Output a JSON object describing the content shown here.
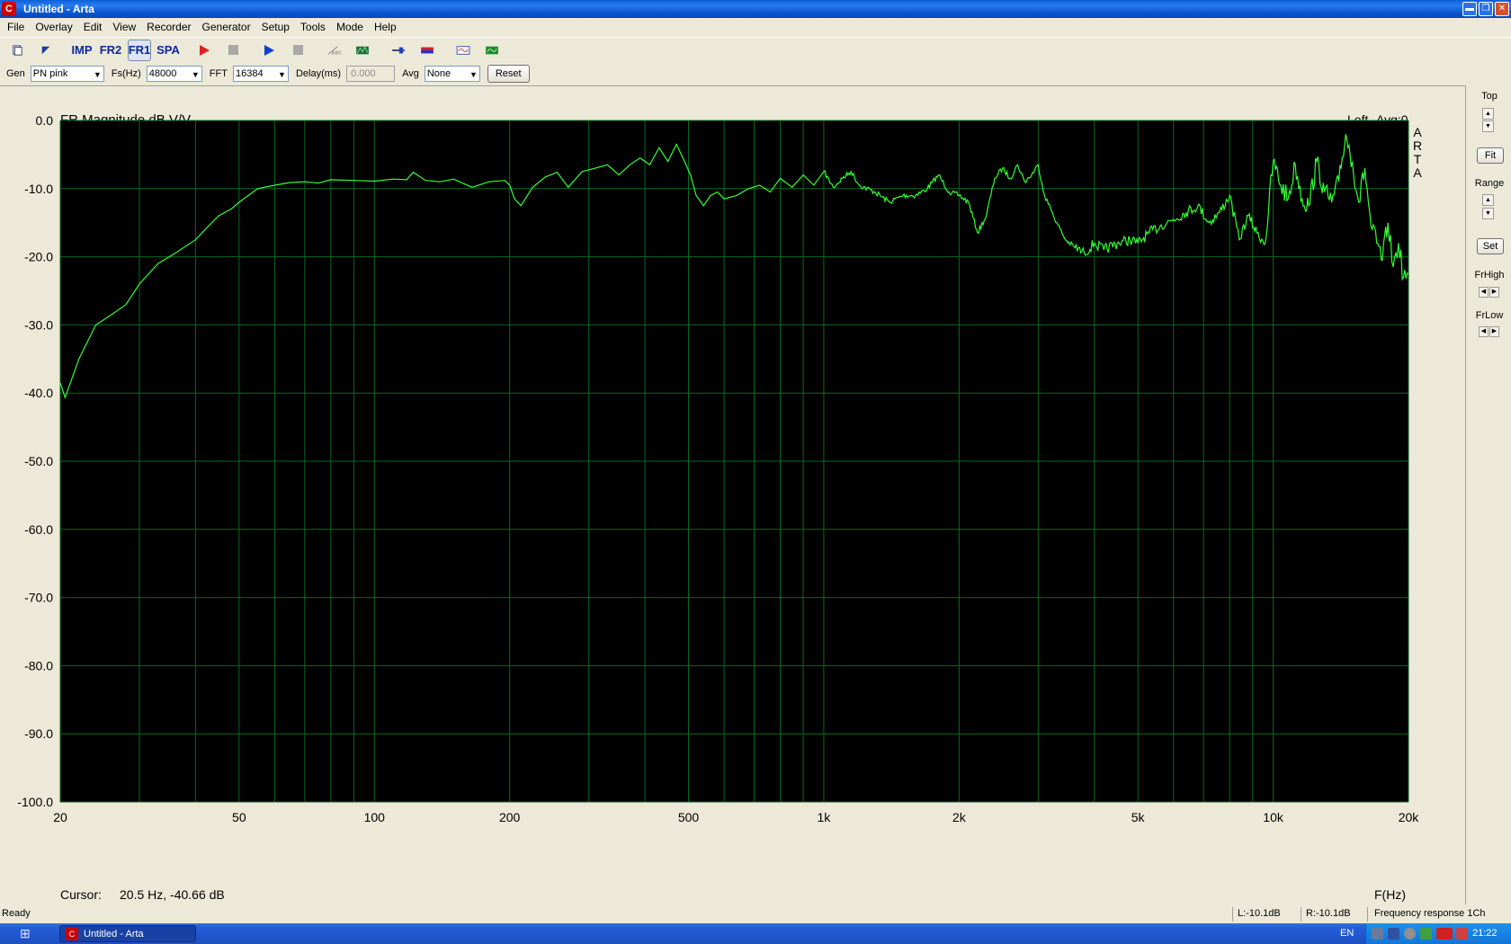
{
  "window": {
    "title": "Untitled - Arta",
    "app_icon": "C",
    "min": "▬",
    "max": "❐",
    "close": "✕"
  },
  "menu": [
    "File",
    "Overlay",
    "Edit",
    "View",
    "Recorder",
    "Generator",
    "Setup",
    "Tools",
    "Mode",
    "Help"
  ],
  "toolbar": {
    "imp": "IMP",
    "fr2": "FR2",
    "fr1": "FR1",
    "spa": "SPA",
    "icons": [
      "new-document-icon",
      "open-icon",
      "play-red-icon",
      "stop-icon",
      "play-blue-icon",
      "stop-icon",
      "abc-icon",
      "overlay-icon",
      "slider-icon",
      "color-bar-icon",
      "scope-blue-icon",
      "scope-green-icon"
    ]
  },
  "controls": {
    "gen_label": "Gen",
    "gen_value": "PN pink",
    "fs_label": "Fs(Hz)",
    "fs_value": "48000",
    "fft_label": "FFT",
    "fft_value": "16384",
    "delay_label": "Delay(ms)",
    "delay_value": "0.000",
    "avg_label": "Avg",
    "avg_value": "None",
    "reset_label": "Reset"
  },
  "chart_data": {
    "type": "line",
    "title": "FR Magnitude dB V/V",
    "channel_label": "Left",
    "avg_label": "Avg:0",
    "watermark": [
      "A",
      "R",
      "T",
      "A"
    ],
    "xlabel": "F(Hz)",
    "x_scale": "log",
    "xlim": [
      20,
      20000
    ],
    "ylim": [
      -100,
      0
    ],
    "x_ticks": [
      20,
      50,
      100,
      200,
      500,
      1000,
      2000,
      5000,
      10000,
      20000
    ],
    "x_tick_labels": [
      "20",
      "50",
      "100",
      "200",
      "500",
      "1k",
      "2k",
      "5k",
      "10k",
      "20k"
    ],
    "y_ticks": [
      0,
      -10,
      -20,
      -30,
      -40,
      -50,
      -60,
      -70,
      -80,
      -90,
      -100
    ],
    "y_tick_labels": [
      "0.0",
      "-10.0",
      "-20.0",
      "-30.0",
      "-40.0",
      "-50.0",
      "-60.0",
      "-70.0",
      "-80.0",
      "-90.0",
      "-100.0"
    ],
    "grid": true,
    "colors": {
      "background": "#000000",
      "grid": "#0a6a22",
      "trace": "#33ff33",
      "axis_text": "#000000"
    },
    "cursor_label": "Cursor:",
    "cursor_value": "20.5 Hz, -40.66 dB",
    "series": [
      {
        "x": [
          20,
          20.5,
          22,
          24,
          26,
          28,
          30,
          33,
          36,
          40,
          42,
          45,
          48,
          50,
          55,
          60,
          65,
          70,
          75,
          80,
          90,
          100,
          110,
          118,
          122,
          130,
          140,
          150,
          165,
          180,
          195,
          200,
          205,
          212,
          225,
          240,
          255,
          270,
          290,
          310,
          330,
          350,
          370,
          390,
          410,
          430,
          450,
          470,
          490,
          505,
          520,
          540,
          560,
          580,
          600,
          640,
          680,
          720,
          760,
          800,
          850,
          900,
          950,
          1000,
          1050,
          1100,
          1150,
          1200,
          1300,
          1400,
          1500,
          1600,
          1700,
          1800,
          1900,
          2000,
          2100,
          2200,
          2300,
          2400,
          2500,
          2600,
          2700,
          2800,
          2900,
          3000,
          3100,
          3200,
          3300,
          3450,
          3600,
          3800,
          4000,
          4200,
          4500,
          4800,
          5000,
          5300,
          5600,
          6000,
          6400,
          6800,
          7200,
          7600,
          8000,
          8400,
          8800,
          9200,
          9600,
          10000,
          10400,
          10800,
          11200,
          11600,
          12000,
          12500,
          13000,
          13500,
          14000,
          14500,
          15000,
          15500,
          16000,
          16500,
          17000,
          17500,
          18000,
          18500,
          19000,
          19500,
          20000
        ],
        "y": [
          -38.5,
          -40.66,
          -35,
          -30,
          -28.5,
          -27,
          -24,
          -21,
          -19.5,
          -17.5,
          -16,
          -14,
          -13,
          -12,
          -10,
          -9.5,
          -9.1,
          -9,
          -9.2,
          -8.7,
          -8.8,
          -8.9,
          -8.6,
          -8.7,
          -7.6,
          -8.8,
          -9.0,
          -8.6,
          -9.8,
          -9.0,
          -8.8,
          -9.5,
          -11.5,
          -12.5,
          -9.8,
          -8.3,
          -7.6,
          -9.8,
          -7.5,
          -7.0,
          -6.5,
          -8.0,
          -6.5,
          -5.5,
          -6.5,
          -4.0,
          -6.0,
          -3.5,
          -6.0,
          -8.0,
          -11.0,
          -12.5,
          -11.0,
          -10.5,
          -11.5,
          -11.0,
          -10.0,
          -9.5,
          -10.5,
          -8.5,
          -9.8,
          -8.0,
          -9.5,
          -7.5,
          -9.8,
          -8.5,
          -7.5,
          -9.5,
          -10.5,
          -12.0,
          -11.0,
          -11.0,
          -10.0,
          -8.0,
          -10.5,
          -11.0,
          -12.0,
          -16.5,
          -14.0,
          -8.5,
          -7.0,
          -8.5,
          -6.5,
          -9.0,
          -8.0,
          -6.5,
          -11.0,
          -13.0,
          -15.0,
          -17.5,
          -18.5,
          -19.5,
          -18.0,
          -19.0,
          -18.0,
          -17.5,
          -18.0,
          -16.5,
          -15.5,
          -14.5,
          -13.5,
          -12.5,
          -15.0,
          -13.5,
          -11.0,
          -17.5,
          -14.0,
          -16.5,
          -18.0,
          -6.0,
          -9.5,
          -11.5,
          -6.5,
          -11.5,
          -12.5,
          -6.0,
          -10.5,
          -12.0,
          -9.0,
          -2.0,
          -6.0,
          -12.0,
          -7.0,
          -15.5,
          -18.0,
          -20.5,
          -15.0,
          -21.5,
          -18.0,
          -23.0,
          -22.5
        ]
      }
    ]
  },
  "right_panel": {
    "top_label": "Top",
    "fit_label": "Fit",
    "range_label": "Range",
    "set_label": "Set",
    "frhigh_label": "FrHigh",
    "frlow_label": "FrLow",
    "up": "▲",
    "down": "▼",
    "left": "◀",
    "right": "▶"
  },
  "status": {
    "ready": "Ready",
    "left_level": "L:-10.1dB",
    "right_level": "R:-10.1dB",
    "mode": "Frequency response 1Ch"
  },
  "taskbar": {
    "start_icon": "windows-flag-icon",
    "start_glyph": "⊞",
    "task_label": "Untitled - Arta",
    "lang": "EN",
    "clock": "21:22"
  }
}
